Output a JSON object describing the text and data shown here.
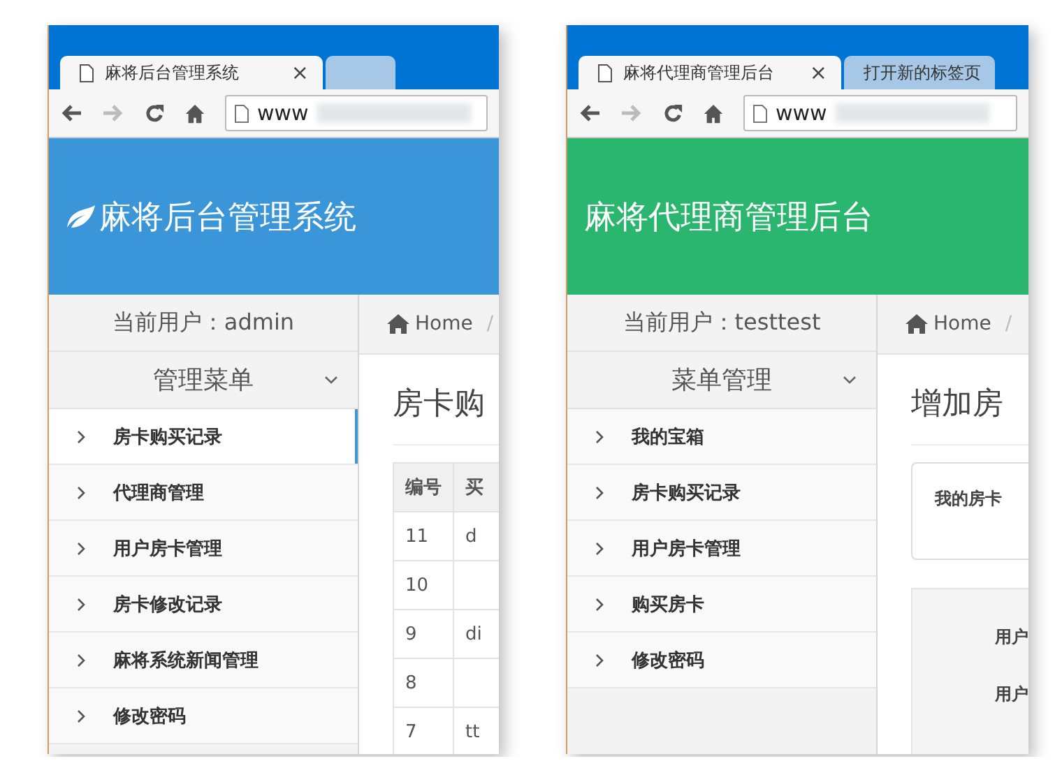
{
  "windows": [
    {
      "color": "#3a96d9",
      "leaf_icon": true,
      "tabs": [
        {
          "label": "麻将后台管理系统",
          "selected": true,
          "close": "×"
        },
        {
          "selected": false
        }
      ],
      "address": "www",
      "header_title": "麻将后台管理系统",
      "sidebar": {
        "current_user": "当前用户：admin",
        "menu_title": "管理菜单",
        "items": [
          {
            "label": "房卡购买记录",
            "selected": true
          },
          {
            "label": "代理商管理",
            "selected": false
          },
          {
            "label": "用户房卡管理",
            "selected": false
          },
          {
            "label": "房卡修改记录",
            "selected": false
          },
          {
            "label": "麻将系统新闻管理",
            "selected": false
          },
          {
            "label": "修改密码",
            "selected": false
          }
        ]
      },
      "breadcrumb": {
        "home": "Home",
        "separator": "/"
      },
      "page_title": "房卡购",
      "content": {
        "kind": "table",
        "columns": [
          "编号",
          "买"
        ],
        "rows": [
          [
            "11",
            "d"
          ],
          [
            "10"
          ],
          [
            "9",
            "di"
          ],
          [
            "8"
          ],
          [
            "7",
            "tt"
          ]
        ]
      }
    },
    {
      "color": "#2ab66f",
      "leaf_icon": false,
      "tabs": [
        {
          "label": "麻将代理商管理后台",
          "selected": true,
          "close": "×"
        },
        {
          "label": "打开新的标签页",
          "selected": false
        }
      ],
      "address": "www",
      "header_title": "麻将代理商管理后台",
      "sidebar": {
        "current_user": "当前用户：testtest",
        "menu_title": "菜单管理",
        "items": [
          {
            "label": "我的宝箱",
            "selected": false
          },
          {
            "label": "房卡购买记录",
            "selected": false
          },
          {
            "label": "用户房卡管理",
            "selected": false
          },
          {
            "label": "购买房卡",
            "selected": false
          },
          {
            "label": "修改密码",
            "selected": false
          }
        ]
      },
      "breadcrumb": {
        "home": "Home",
        "separator": "/"
      },
      "page_title": "增加房",
      "content": {
        "kind": "form",
        "info": "我的房卡",
        "labels": [
          "用户",
          "用户"
        ]
      }
    }
  ]
}
